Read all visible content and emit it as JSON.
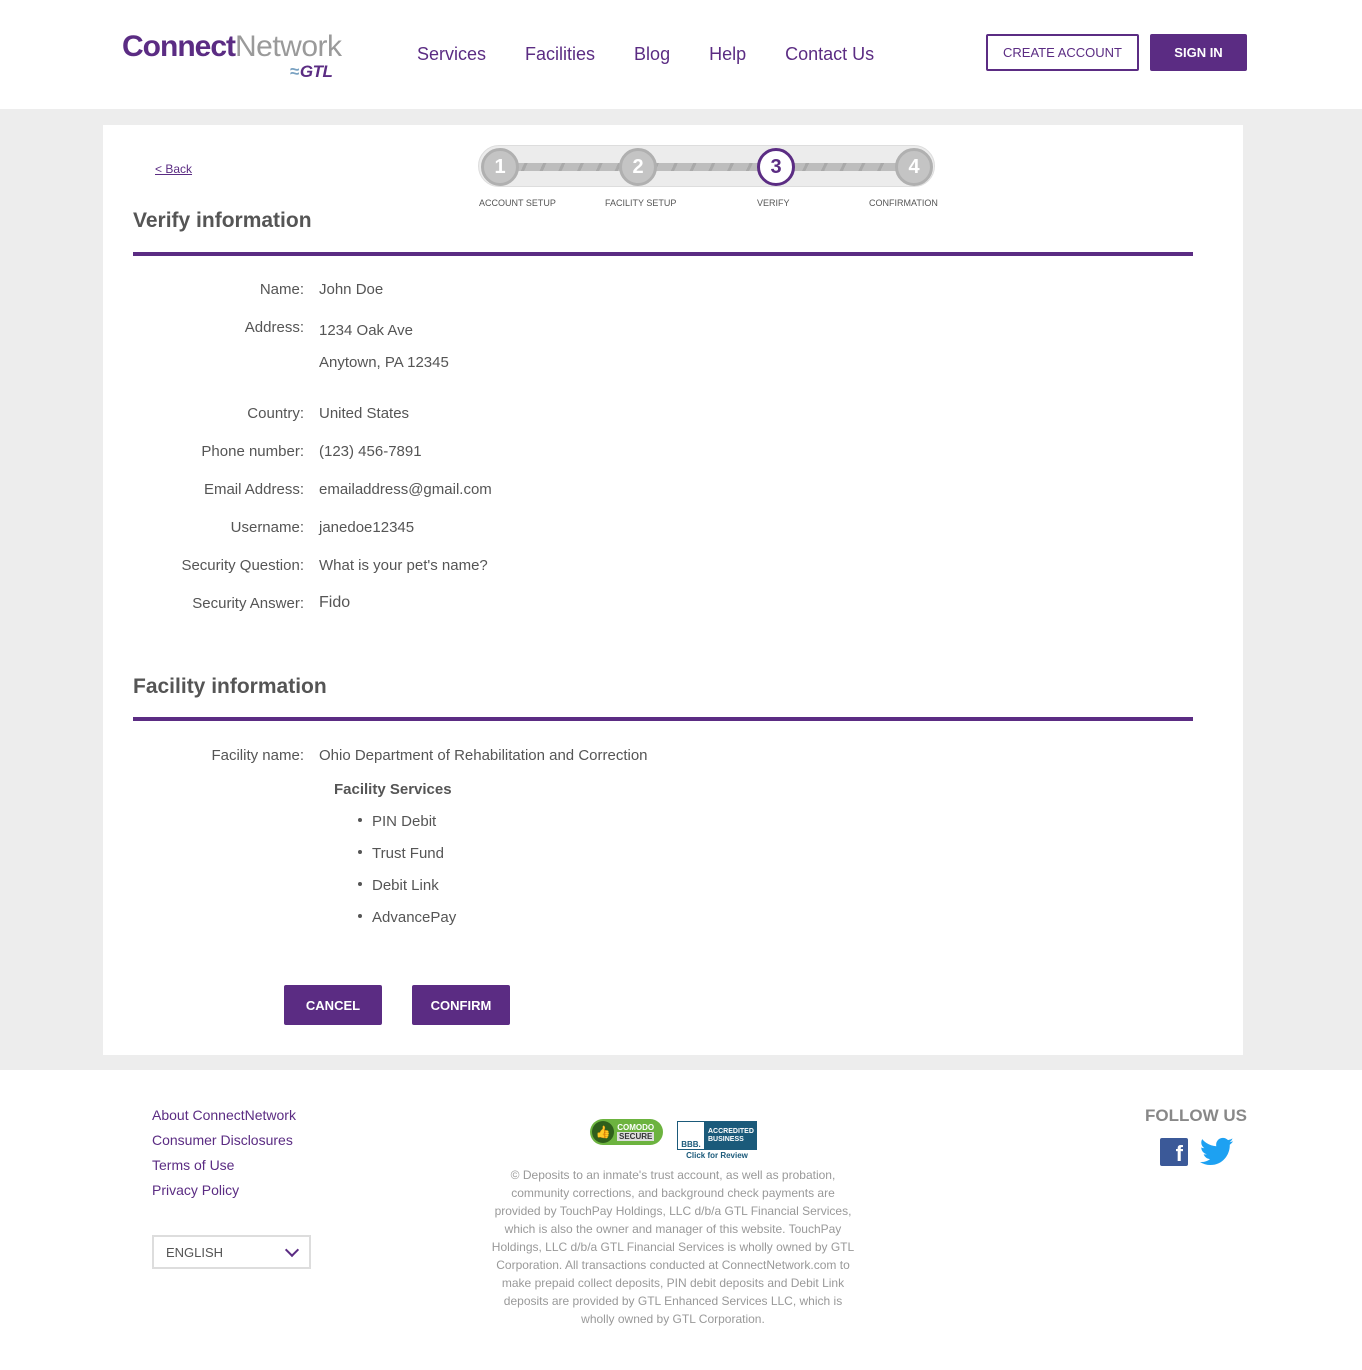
{
  "header": {
    "logo": {
      "connect": "Connect",
      "network": "Network",
      "gtl": "GTL"
    },
    "nav": [
      "Services",
      "Facilities",
      "Blog",
      "Help",
      "Contact Us"
    ],
    "create_account": "CREATE ACCOUNT",
    "sign_in": "SIGN IN"
  },
  "back_link": "< Back",
  "stepper": {
    "current_step": 3,
    "steps": [
      {
        "number": "1",
        "label": "ACCOUNT SETUP"
      },
      {
        "number": "2",
        "label": "FACILITY SETUP"
      },
      {
        "number": "3",
        "label": "VERIFY"
      },
      {
        "number": "4",
        "label": "CONFIRMATION"
      }
    ]
  },
  "verify": {
    "title": "Verify information",
    "fields": {
      "name": {
        "label": "Name:",
        "value": "John  Doe"
      },
      "address": {
        "label": "Address:",
        "line1": "1234 Oak Ave",
        "line2": "Anytown, PA 12345"
      },
      "country": {
        "label": "Country:",
        "value": "United States"
      },
      "phone": {
        "label": "Phone number:",
        "value": "(123) 456-7891"
      },
      "email": {
        "label": "Email Address:",
        "value": "emailaddress@gmail.com"
      },
      "username": {
        "label": "Username:",
        "value": "janedoe12345"
      },
      "security_question": {
        "label": "Security Question:",
        "value": "What is your pet's name?"
      },
      "security_answer": {
        "label": "Security Answer:",
        "value": "Fido"
      }
    }
  },
  "facility": {
    "title": "Facility information",
    "name_label": "Facility name:",
    "name_value": "Ohio Department of Rehabilitation and Correction",
    "services_title": "Facility Services",
    "services": [
      "PIN Debit",
      "Trust Fund",
      "Debit Link",
      "AdvancePay"
    ]
  },
  "actions": {
    "cancel": "CANCEL",
    "confirm": "CONFIRM"
  },
  "footer": {
    "links": [
      "About ConnectNetwork",
      "Consumer Disclosures",
      "Terms of Use",
      "Privacy Policy"
    ],
    "language": "ENGLISH",
    "badges": {
      "comodo_top": "COMODO",
      "comodo_bottom": "SECURE",
      "bbb_logo": "BBB.",
      "bbb_text": "ACCREDITED BUSINESS",
      "bbb_review": "Click for Review"
    },
    "disclaimer": "© Deposits to an inmate's trust account, as well as probation, community corrections, and background check payments are provided by TouchPay Holdings, LLC d/b/a GTL Financial Services, which is also the owner and manager of this website. TouchPay Holdings, LLC d/b/a GTL Financial Services is wholly owned by GTL Corporation. All transactions conducted at ConnectNetwork.com to make prepaid collect deposits, PIN debit deposits and Debit Link deposits are provided by GTL Enhanced Services LLC, which is wholly owned by GTL Corporation.",
    "follow_us": "FOLLOW US",
    "social": [
      "facebook-icon",
      "twitter-icon"
    ]
  },
  "colors": {
    "brand_purple": "#5b2c83",
    "page_bg": "#ededed"
  }
}
